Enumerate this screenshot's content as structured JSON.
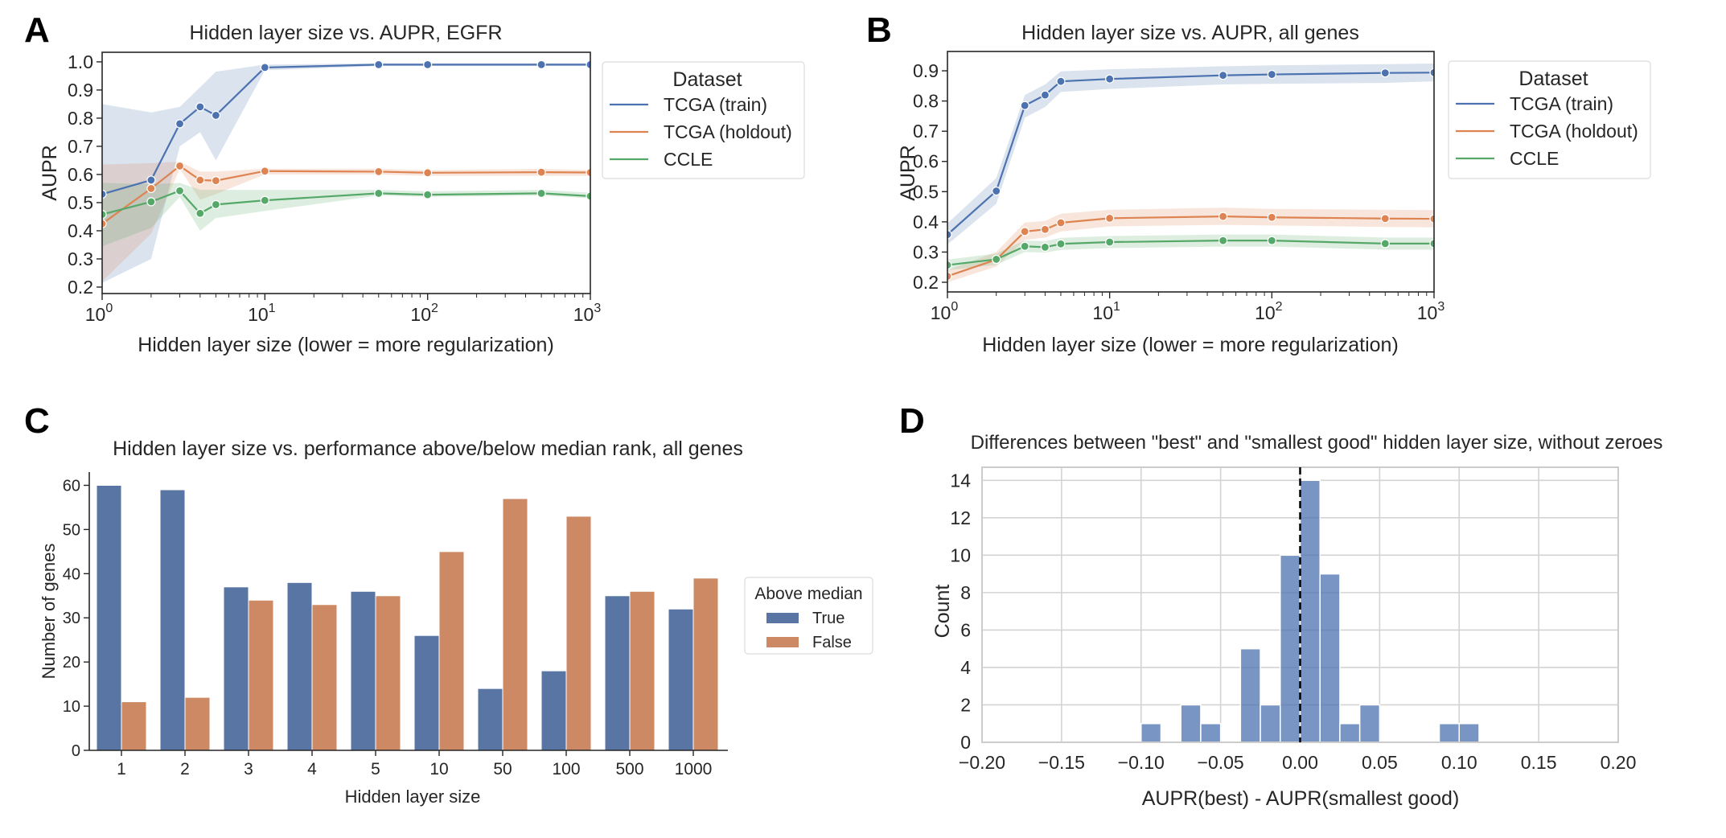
{
  "panels": {
    "A": "A",
    "B": "B",
    "C": "C",
    "D": "D"
  },
  "chart_data": [
    {
      "id": "A",
      "type": "line",
      "title": "Hidden layer size vs. AUPR, EGFR",
      "xlabel": "Hidden layer size (lower = more regularization)",
      "ylabel": "AUPR",
      "xscale": "log",
      "xlim": [
        1,
        1000
      ],
      "ylim": [
        0.177,
        1.034
      ],
      "xticks": [
        {
          "v": 1,
          "base": "10",
          "exp": "0"
        },
        {
          "v": 10,
          "base": "10",
          "exp": "1"
        },
        {
          "v": 100,
          "base": "10",
          "exp": "2"
        },
        {
          "v": 1000,
          "base": "10",
          "exp": "3"
        }
      ],
      "yticks": [
        0.2,
        0.3,
        0.4,
        0.5,
        0.6,
        0.7,
        0.8,
        0.9,
        1.0
      ],
      "ytick_labels": [
        "0.2",
        "0.3",
        "0.4",
        "0.5",
        "0.6",
        "0.7",
        "0.8",
        "0.9",
        "1.0"
      ],
      "legend": {
        "title": "Dataset",
        "placement": "outside-right-top"
      },
      "x": [
        1,
        2,
        3,
        4,
        5,
        10,
        50,
        100,
        500,
        1000
      ],
      "series": [
        {
          "name": "TCGA (train)",
          "color": "#4c72b0",
          "values": [
            0.53,
            0.58,
            0.78,
            0.84,
            0.81,
            0.98,
            0.99,
            0.99,
            0.99,
            0.99
          ],
          "lower": [
            0.215,
            0.3,
            0.7,
            0.75,
            0.65,
            0.97,
            0.985,
            0.985,
            0.985,
            0.985
          ],
          "upper": [
            0.85,
            0.82,
            0.84,
            0.91,
            0.965,
            0.99,
            0.995,
            0.995,
            0.995,
            0.995
          ]
        },
        {
          "name": "TCGA (holdout)",
          "color": "#dd8452",
          "values": [
            0.425,
            0.55,
            0.63,
            0.58,
            0.578,
            0.612,
            0.61,
            0.606,
            0.608,
            0.607
          ],
          "lower": [
            0.22,
            0.39,
            0.62,
            0.51,
            0.53,
            0.6,
            0.6,
            0.595,
            0.595,
            0.595
          ],
          "upper": [
            0.635,
            0.64,
            0.645,
            0.61,
            0.61,
            0.62,
            0.62,
            0.615,
            0.62,
            0.615
          ]
        },
        {
          "name": "CCLE",
          "color": "#55a868",
          "values": [
            0.458,
            0.503,
            0.542,
            0.462,
            0.493,
            0.508,
            0.533,
            0.528,
            0.533,
            0.523
          ],
          "lower": [
            0.345,
            0.41,
            0.52,
            0.4,
            0.445,
            0.47,
            0.525,
            0.52,
            0.525,
            0.515
          ],
          "upper": [
            0.57,
            0.565,
            0.57,
            0.545,
            0.545,
            0.545,
            0.545,
            0.54,
            0.545,
            0.535
          ]
        }
      ]
    },
    {
      "id": "B",
      "type": "line",
      "title": "Hidden layer size vs. AUPR, all genes",
      "xlabel": "Hidden layer size (lower = more regularization)",
      "ylabel": "AUPR",
      "xscale": "log",
      "xlim": [
        1,
        1000
      ],
      "ylim": [
        0.168,
        0.964
      ],
      "xticks": [
        {
          "v": 1,
          "base": "10",
          "exp": "0"
        },
        {
          "v": 10,
          "base": "10",
          "exp": "1"
        },
        {
          "v": 100,
          "base": "10",
          "exp": "2"
        },
        {
          "v": 1000,
          "base": "10",
          "exp": "3"
        }
      ],
      "yticks": [
        0.2,
        0.3,
        0.4,
        0.5,
        0.6,
        0.7,
        0.8,
        0.9
      ],
      "ytick_labels": [
        "0.2",
        "0.3",
        "0.4",
        "0.5",
        "0.6",
        "0.7",
        "0.8",
        "0.9"
      ],
      "legend": {
        "title": "Dataset",
        "placement": "outside-right-top"
      },
      "x": [
        1,
        2,
        3,
        4,
        5,
        10,
        50,
        100,
        500,
        1000
      ],
      "series": [
        {
          "name": "TCGA (train)",
          "color": "#4c72b0",
          "values": [
            0.358,
            0.502,
            0.785,
            0.82,
            0.865,
            0.873,
            0.885,
            0.888,
            0.893,
            0.894
          ],
          "lower": [
            0.325,
            0.46,
            0.745,
            0.78,
            0.83,
            0.84,
            0.855,
            0.857,
            0.86,
            0.865
          ],
          "upper": [
            0.395,
            0.545,
            0.82,
            0.855,
            0.898,
            0.905,
            0.915,
            0.918,
            0.922,
            0.924
          ]
        },
        {
          "name": "TCGA (holdout)",
          "color": "#dd8452",
          "values": [
            0.22,
            0.275,
            0.368,
            0.375,
            0.397,
            0.412,
            0.418,
            0.415,
            0.411,
            0.41
          ],
          "lower": [
            0.2,
            0.252,
            0.34,
            0.348,
            0.368,
            0.385,
            0.39,
            0.388,
            0.383,
            0.382
          ],
          "upper": [
            0.24,
            0.3,
            0.398,
            0.403,
            0.427,
            0.44,
            0.447,
            0.443,
            0.44,
            0.439
          ]
        },
        {
          "name": "CCLE",
          "color": "#55a868",
          "values": [
            0.257,
            0.276,
            0.319,
            0.316,
            0.327,
            0.333,
            0.338,
            0.338,
            0.328,
            0.328
          ],
          "lower": [
            0.24,
            0.258,
            0.3,
            0.298,
            0.307,
            0.313,
            0.318,
            0.318,
            0.308,
            0.308
          ],
          "upper": [
            0.275,
            0.295,
            0.338,
            0.336,
            0.347,
            0.353,
            0.358,
            0.358,
            0.348,
            0.348
          ]
        }
      ]
    },
    {
      "id": "C",
      "type": "bar",
      "title": "Hidden layer size vs. performance above/below median rank, all genes",
      "xlabel": "Hidden layer size",
      "ylabel": "Number of genes",
      "ylim": [
        0,
        63
      ],
      "yticks": [
        0,
        10,
        20,
        30,
        40,
        50,
        60
      ],
      "categories": [
        "1",
        "2",
        "3",
        "4",
        "5",
        "10",
        "50",
        "100",
        "500",
        "1000"
      ],
      "legend": {
        "title": "Above median",
        "placement": "outside-right"
      },
      "series": [
        {
          "name": "True",
          "color": "#5875a4",
          "values": [
            60,
            59,
            37,
            38,
            36,
            26,
            14,
            18,
            35,
            32
          ]
        },
        {
          "name": "False",
          "color": "#cc8963",
          "values": [
            11,
            12,
            34,
            33,
            35,
            45,
            57,
            53,
            36,
            39
          ]
        }
      ]
    },
    {
      "id": "D",
      "type": "bar",
      "subtype": "histogram",
      "title": "Differences between \"best\" and \"smallest good\" hidden layer size, without zeroes",
      "xlabel": "AUPR(best) - AUPR(smallest good)",
      "ylabel": "Count",
      "xlim": [
        -0.2,
        0.2
      ],
      "ylim": [
        0,
        14.7
      ],
      "xticks": [
        -0.2,
        -0.15,
        -0.1,
        -0.05,
        0.0,
        0.05,
        0.1,
        0.15,
        0.2
      ],
      "xtick_labels": [
        "−0.20",
        "−0.15",
        "−0.10",
        "−0.05",
        "0.00",
        "0.05",
        "0.10",
        "0.15",
        "0.20"
      ],
      "yticks": [
        0,
        2,
        4,
        6,
        8,
        10,
        12,
        14
      ],
      "grid": true,
      "color": "#4c72b0",
      "vline": {
        "x": 0.0,
        "style": "dashed",
        "color": "#000000"
      },
      "bin_width": 0.0125,
      "bins": [
        {
          "start": -0.1,
          "count": 1
        },
        {
          "start": -0.075,
          "count": 2
        },
        {
          "start": -0.0625,
          "count": 1
        },
        {
          "start": -0.0375,
          "count": 5
        },
        {
          "start": -0.025,
          "count": 2
        },
        {
          "start": -0.0125,
          "count": 10
        },
        {
          "start": 0.0,
          "count": 14
        },
        {
          "start": 0.0125,
          "count": 9
        },
        {
          "start": 0.025,
          "count": 1
        },
        {
          "start": 0.0375,
          "count": 2
        },
        {
          "start": 0.0875,
          "count": 1
        },
        {
          "start": 0.1,
          "count": 1
        }
      ]
    }
  ]
}
